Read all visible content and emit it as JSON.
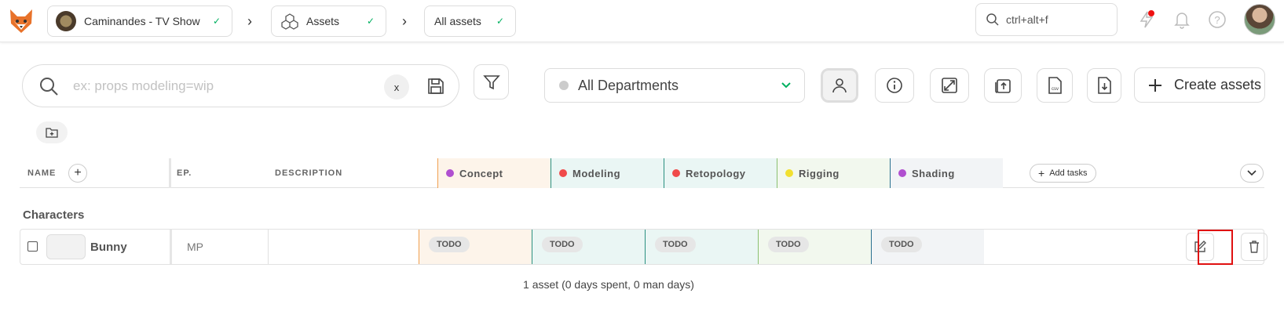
{
  "topbar": {
    "production": "Caminandes - TV Show",
    "section": "Assets",
    "filter_view": "All assets",
    "search_placeholder": "ctrl+alt+f",
    "icons": [
      "lightning-icon",
      "bell-icon",
      "help-icon"
    ]
  },
  "toolbar": {
    "search_placeholder": "ex: props modeling=wip",
    "clear_label": "x",
    "department": "All Departments",
    "create_label": "Create assets"
  },
  "table": {
    "headers": {
      "name": "NAME",
      "episode": "EP.",
      "description": "DESCRIPTION",
      "add_tasks": "Add tasks"
    },
    "tasks": [
      {
        "name": "Concept",
        "color": "#b04fd0",
        "bg": "#fdf4ea",
        "border": "#f0a050"
      },
      {
        "name": "Modeling",
        "color": "#f04a4a",
        "bg": "#eaf6f4",
        "border": "#2a9080"
      },
      {
        "name": "Retopology",
        "color": "#f04a4a",
        "bg": "#eaf6f4",
        "border": "#2a9080"
      },
      {
        "name": "Rigging",
        "color": "#f2e030",
        "bg": "#f2f8ee",
        "border": "#8ac070"
      },
      {
        "name": "Shading",
        "color": "#b04fd0",
        "bg": "#f2f4f6",
        "border": "#2a7090"
      }
    ],
    "groups": [
      {
        "title": "Characters",
        "rows": [
          {
            "name": "Bunny",
            "episode": "MP",
            "description": "",
            "statuses": [
              "TODO",
              "TODO",
              "TODO",
              "TODO",
              "TODO"
            ]
          }
        ]
      }
    ]
  },
  "footer": {
    "stats": "1 asset (0 days spent, 0 man days)"
  }
}
